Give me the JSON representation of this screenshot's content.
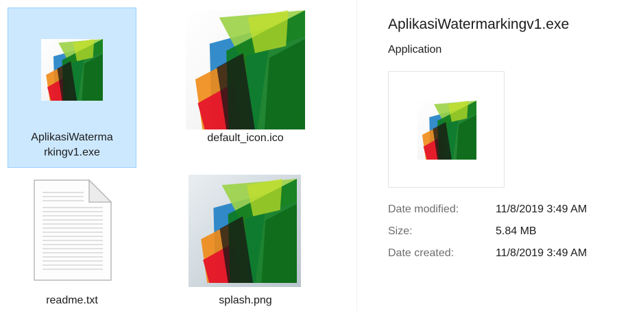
{
  "files": [
    {
      "name": "AplikasiWatermarkingv1.exe",
      "name_line1": "AplikasiWaterma",
      "name_line2": "rkingv1.exe",
      "selected": true,
      "icon": "app-logo-icon"
    },
    {
      "name": "default_icon.ico",
      "selected": false,
      "icon": "app-logo-icon"
    },
    {
      "name": "readme.txt",
      "selected": false,
      "icon": "text-document-icon"
    },
    {
      "name": "splash.png",
      "selected": false,
      "icon": "image-thumbnail-icon"
    }
  ],
  "details": {
    "title": "AplikasiWatermarkingv1.exe",
    "type": "Application",
    "preview_icon": "app-logo-icon",
    "properties": [
      {
        "key": "Date modified:",
        "value": "11/8/2019 3:49 AM"
      },
      {
        "key": "Size:",
        "value": "5.84 MB"
      },
      {
        "key": "Date created:",
        "value": "11/8/2019 3:49 AM"
      }
    ]
  },
  "colors": {
    "selection_bg": "#cce8ff",
    "selection_border": "#99d1ff",
    "label_muted": "#6d6d6d"
  }
}
